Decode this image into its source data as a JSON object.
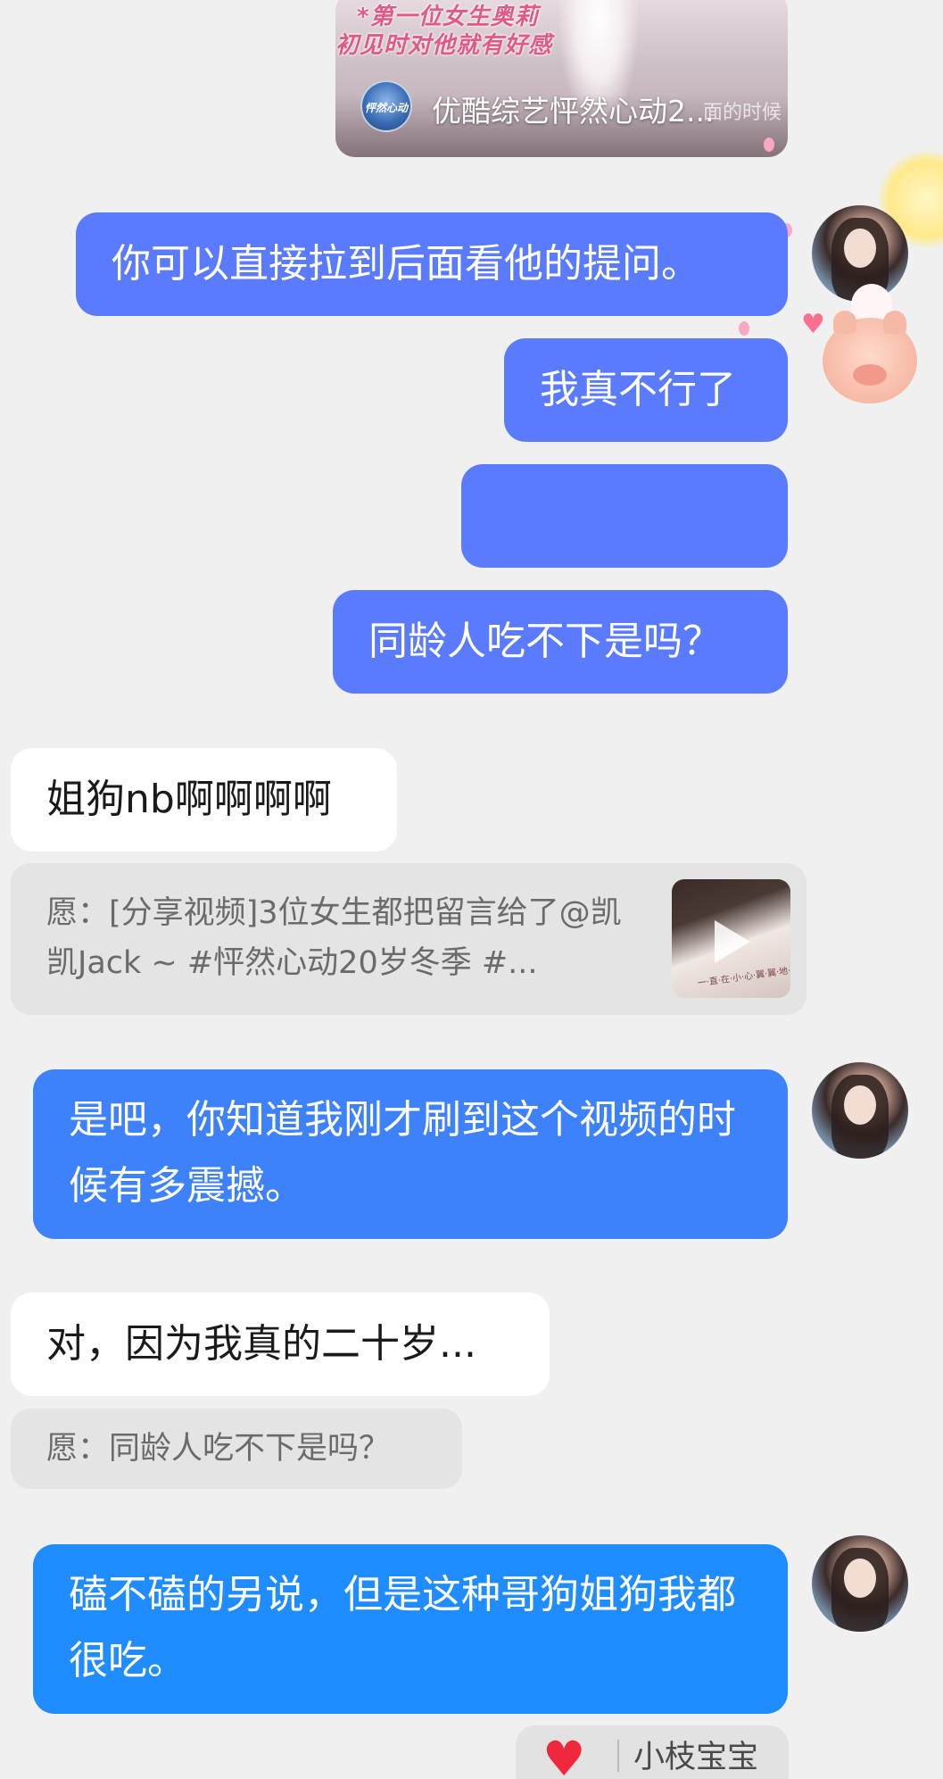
{
  "video_card": {
    "caption_line_1": "*第一位女生奥莉",
    "caption_line_2": "初见时对他就有好感",
    "channel_badge": "怦然心动",
    "channel_name": "优酷综艺怦然心动2...",
    "channel_tail": "面的时候"
  },
  "messages": [
    {
      "side": "out",
      "text": "你可以直接拉到后面看他的提问。"
    },
    {
      "side": "out",
      "text": "我真不行了"
    },
    {
      "side": "out",
      "text": ""
    },
    {
      "side": "out",
      "text": "同龄人吃不下是吗？"
    },
    {
      "side": "in",
      "text": "姐狗nb啊啊啊啊"
    },
    {
      "side": "in_quote",
      "text": "愿：[分享视频]3位女生都把留言给了@凯凯Jack ~ #怦然心动20岁冬季  #..."
    },
    {
      "side": "out",
      "text": "是吧，你知道我刚才刷到这个视频的时候有多震撼。"
    },
    {
      "side": "in",
      "text": "对，因为我真的二十岁..."
    },
    {
      "side": "in_quote",
      "text": "愿：同龄人吃不下是吗？"
    },
    {
      "side": "out",
      "text": "磕不磕的另说，但是这种哥狗姐狗我都很吃。"
    }
  ],
  "share_thumb": {
    "icon": "play-icon",
    "caption": "一·直·在·小·心·翼·翼·地·看·着·你"
  },
  "reaction": {
    "icon": "heart-icon",
    "name": "小枝宝宝"
  },
  "colors": {
    "background": "#f0f0f0",
    "outgoing_bubble": "#5b7bff",
    "outgoing_bubble_2": "#3e82fb",
    "outgoing_bubble_3": "#1f8cff",
    "incoming_bubble": "#ffffff",
    "quote_bg": "#e4e4e4",
    "heart": "#f0283c"
  }
}
